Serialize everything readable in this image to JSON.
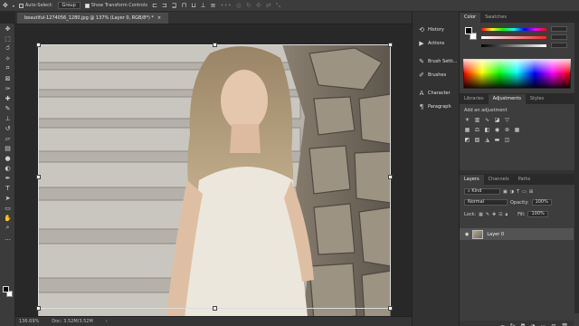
{
  "options_bar": {
    "move_icon": "move-icon",
    "auto_select_label": "Auto-Select:",
    "auto_select_value": "Group",
    "show_transform_label": "Show Transform Controls"
  },
  "document": {
    "tab_title": "beautiful-1274056_1280.jpg @ 137% (Layer 0, RGB/8*) *",
    "close_glyph": "×"
  },
  "status": {
    "zoom": "136.69%",
    "doc": "Doc: 3.52M/3.52M"
  },
  "mini_panels": [
    {
      "label": "History",
      "icon": "history-icon",
      "glyph": "⟲"
    },
    {
      "label": "Actions",
      "icon": "actions-icon",
      "glyph": "▶"
    },
    {
      "label": "Brush Setti...",
      "icon": "brush-settings-icon",
      "glyph": "✎"
    },
    {
      "label": "Brushes",
      "icon": "brushes-icon",
      "glyph": "✐"
    },
    {
      "label": "Character",
      "icon": "character-icon",
      "glyph": "A"
    },
    {
      "label": "Paragraph",
      "icon": "paragraph-icon",
      "glyph": "¶"
    }
  ],
  "color_panel": {
    "tabs": [
      "Color",
      "Swatches"
    ],
    "active_tab": "Color"
  },
  "adjustments_panel": {
    "tabs": [
      "Libraries",
      "Adjustments",
      "Styles"
    ],
    "active_tab": "Adjustments",
    "hint": "Add an adjustment"
  },
  "layers_panel": {
    "tabs": [
      "Layers",
      "Channels",
      "Paths"
    ],
    "active_tab": "Layers",
    "filter_value": "Kind",
    "blend_mode": "Normal",
    "opacity_label": "Opacity:",
    "opacity_value": "100%",
    "lock_label": "Lock:",
    "fill_label": "Fill:",
    "fill_value": "100%",
    "layer_name": "Layer 0"
  },
  "colors": {
    "panel_bg": "#323232",
    "panel_body": "#3d3d3d",
    "selected_layer": "#535353",
    "accent_line": "#dcdcdc"
  }
}
